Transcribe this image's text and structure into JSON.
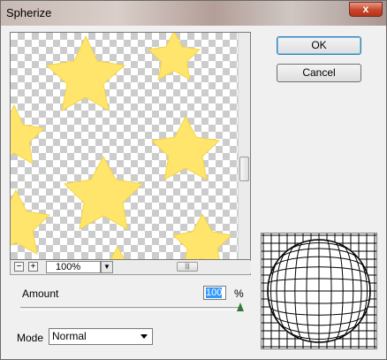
{
  "window": {
    "title": "Spherize",
    "close_label": "x"
  },
  "buttons": {
    "ok_label": "OK",
    "cancel_label": "Cancel"
  },
  "preview": {
    "zoom_value": "100%",
    "zoom_out_label": "−",
    "zoom_in_label": "+",
    "star_color": "#ffe56b"
  },
  "amount": {
    "label": "Amount",
    "value": "100",
    "unit": "%",
    "slider_fraction": 1.0
  },
  "mode": {
    "label": "Mode",
    "selected": "Normal"
  }
}
